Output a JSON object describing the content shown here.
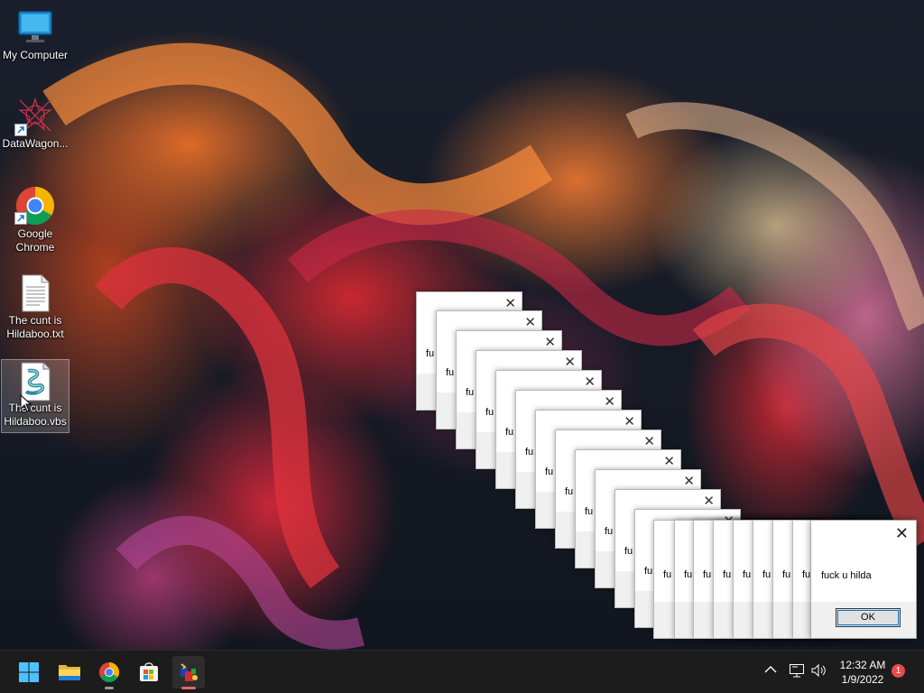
{
  "desktop_icons": [
    {
      "name": "My Computer",
      "icon": "monitor-icon"
    },
    {
      "name": "DataWagon...",
      "icon": "datawagon-icon",
      "shortcut": true
    },
    {
      "name": "Google Chrome",
      "icon": "chrome-icon",
      "shortcut": true
    },
    {
      "name": "The cunt is Hildaboo.txt",
      "icon": "text-file-icon"
    },
    {
      "name": "The cunt is Hildaboo.vbs",
      "icon": "vbs-script-icon",
      "selected": true
    }
  ],
  "dialogs": {
    "stack_fragment": "fu",
    "stack_count": 19,
    "front_message": "fuck u hilda",
    "front_ok_label": "OK",
    "close_glyph": "✕"
  },
  "taskbar": {
    "pinned": [
      "start-button",
      "file-explorer",
      "chrome",
      "microsoft-store",
      "running-script"
    ],
    "active_item": "running-script",
    "time": "12:32 AM",
    "date": "1/9/2022",
    "notification_count": "1"
  },
  "colors": {
    "taskbar_bg": "#1c1c1c",
    "windows_blue": "#0078d7",
    "badge_red": "#e84b4b"
  }
}
